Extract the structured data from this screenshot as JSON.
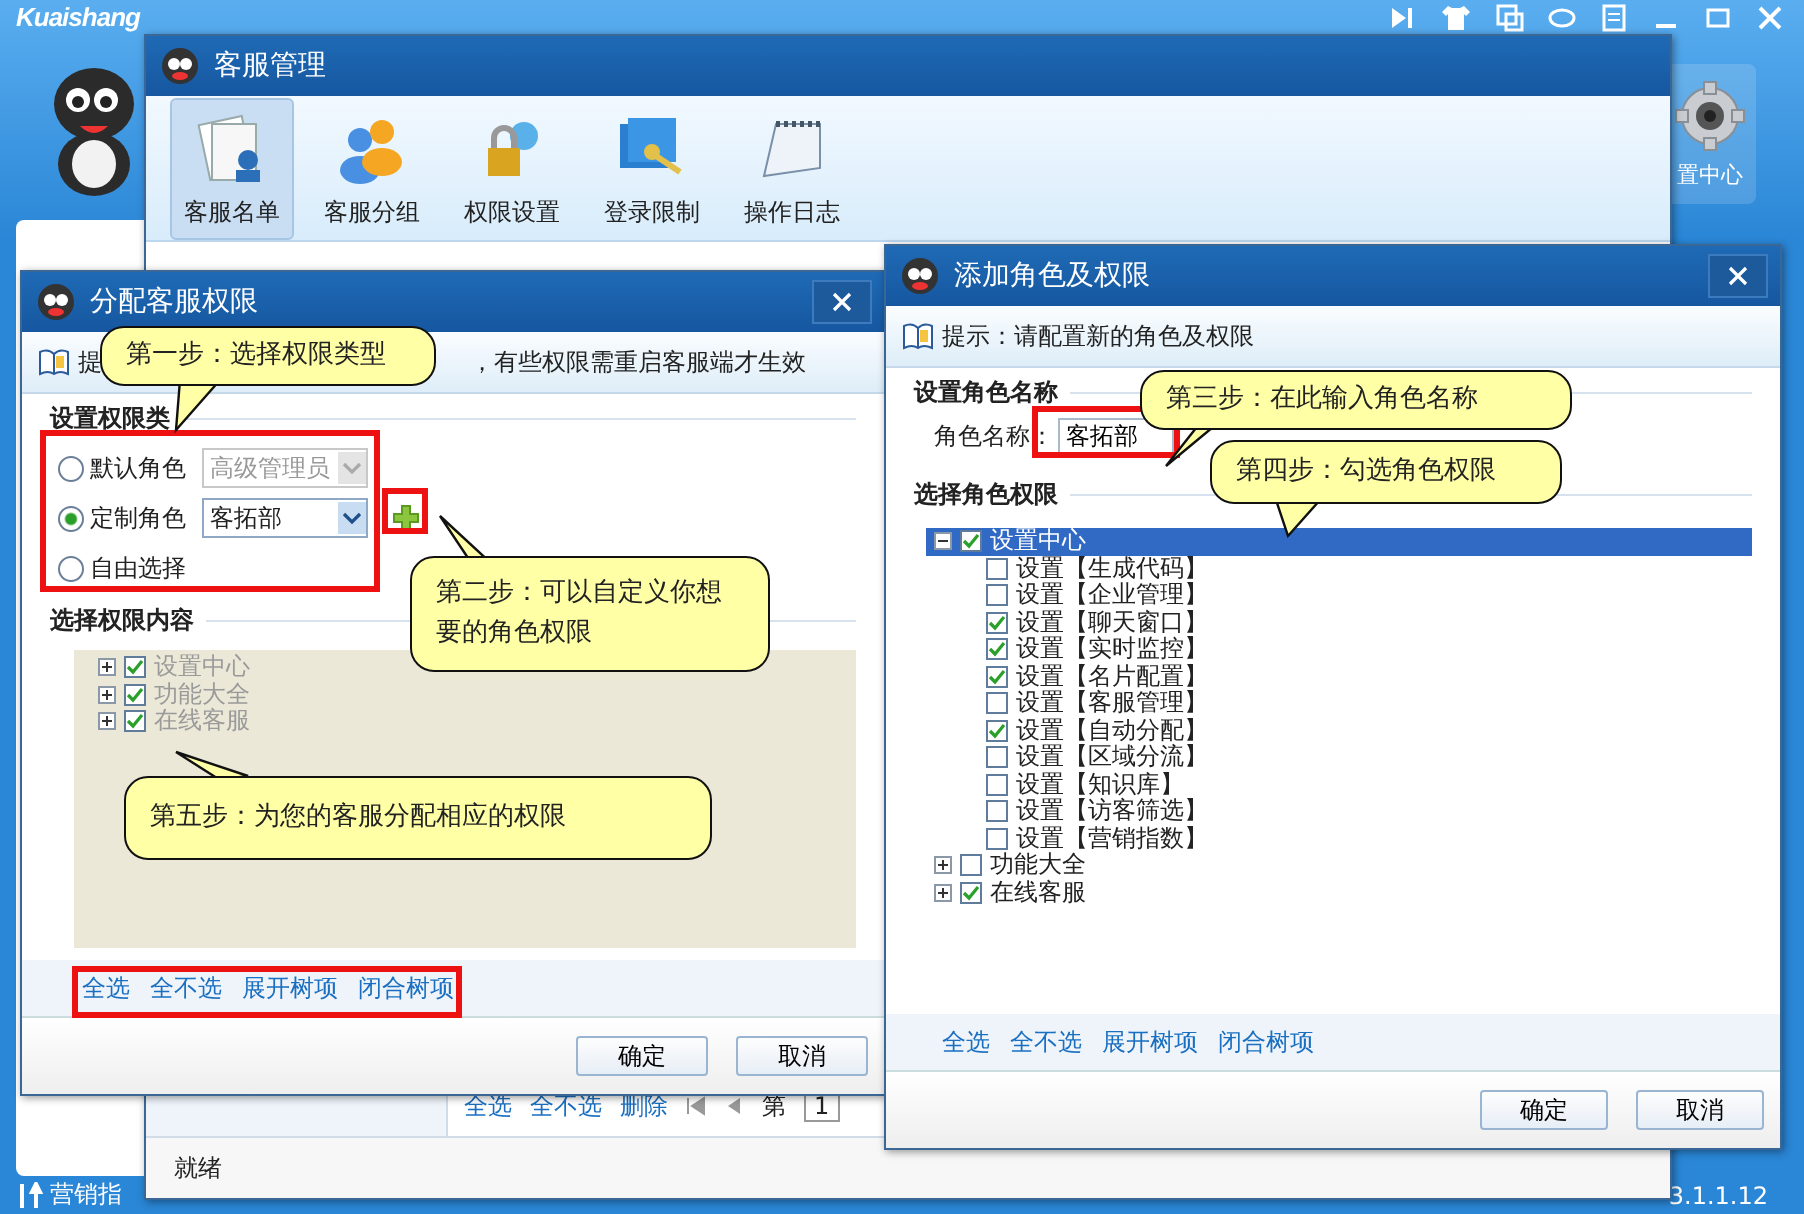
{
  "app": {
    "logo": "Kuaishang",
    "settings_label": "置中心",
    "status_left": "营销指",
    "version": "3.1.1.12"
  },
  "manager": {
    "title": "客服管理",
    "tools": [
      {
        "label": "客服名单",
        "selected": true
      },
      {
        "label": "客服分组",
        "selected": false
      },
      {
        "label": "权限设置",
        "selected": false
      },
      {
        "label": "登录限制",
        "selected": false
      },
      {
        "label": "操作日志",
        "selected": false
      }
    ],
    "links": [
      "全选",
      "全不选",
      "删除"
    ],
    "page_label": "第",
    "page_value": "1",
    "status": "就绪"
  },
  "assign_dialog": {
    "title": "分配客服权限",
    "tip_head": "提",
    "tip": "，有些权限需重启客服端才生效",
    "section_type": "设置权限类",
    "role_options": [
      {
        "label": "默认角色",
        "selected": false,
        "select": {
          "value": "高级管理员",
          "disabled": true
        }
      },
      {
        "label": "定制角色",
        "selected": true,
        "select": {
          "value": "客拓部",
          "disabled": false
        }
      },
      {
        "label": "自由选择",
        "selected": false
      }
    ],
    "section_content": "选择权限内容",
    "tree_disabled": true,
    "tree": [
      {
        "label": "设置中心",
        "checked": true,
        "expanded": false
      },
      {
        "label": "功能大全",
        "checked": true,
        "expanded": false
      },
      {
        "label": "在线客服",
        "checked": true,
        "expanded": false
      }
    ],
    "links": [
      "全选",
      "全不选",
      "展开树项",
      "闭合树项"
    ],
    "buttons": [
      "确定",
      "取消"
    ]
  },
  "role_dialog": {
    "title": "添加角色及权限",
    "tip": "提示：请配置新的角色及权限",
    "section_name": "设置角色名称",
    "name_label": "角色名称：",
    "name_value": "客拓部",
    "section_perm": "选择角色权限",
    "tree": [
      {
        "label": "设置中心",
        "checked": true,
        "expanded": true,
        "selected": true,
        "children": [
          {
            "label": "设置【生成代码】",
            "checked": false,
            "selected": false
          },
          {
            "label": "设置【企业管理】",
            "checked": false,
            "selected": false
          },
          {
            "label": "设置【聊天窗口】",
            "checked": true,
            "selected": false
          },
          {
            "label": "设置【实时监控】",
            "checked": true,
            "selected": false
          },
          {
            "label": "设置【名片配置】",
            "checked": true,
            "selected": false
          },
          {
            "label": "设置【客服管理】",
            "checked": false,
            "selected": false
          },
          {
            "label": "设置【自动分配】",
            "checked": true,
            "selected": false
          },
          {
            "label": "设置【区域分流】",
            "checked": false,
            "selected": false
          },
          {
            "label": "设置【知识库】",
            "checked": false,
            "selected": false
          },
          {
            "label": "设置【访客筛选】",
            "checked": false,
            "selected": false
          },
          {
            "label": "设置【营销指数】",
            "checked": false,
            "selected": false
          }
        ]
      },
      {
        "label": "功能大全",
        "checked": false,
        "expanded": false,
        "selected": false
      },
      {
        "label": "在线客服",
        "checked": true,
        "expanded": false,
        "selected": false
      }
    ],
    "links": [
      "全选",
      "全不选",
      "展开树项",
      "闭合树项"
    ],
    "buttons": [
      "确定",
      "取消"
    ]
  },
  "callouts": [
    {
      "text": "第一步：选择权限类型"
    },
    {
      "text": "第二步：可以自定义你想要的角色权限"
    },
    {
      "text": "第三步：在此输入角色名称"
    },
    {
      "text": "第四步：勾选角色权限"
    },
    {
      "text": "第五步：为您的客服分配相应的权限"
    }
  ]
}
